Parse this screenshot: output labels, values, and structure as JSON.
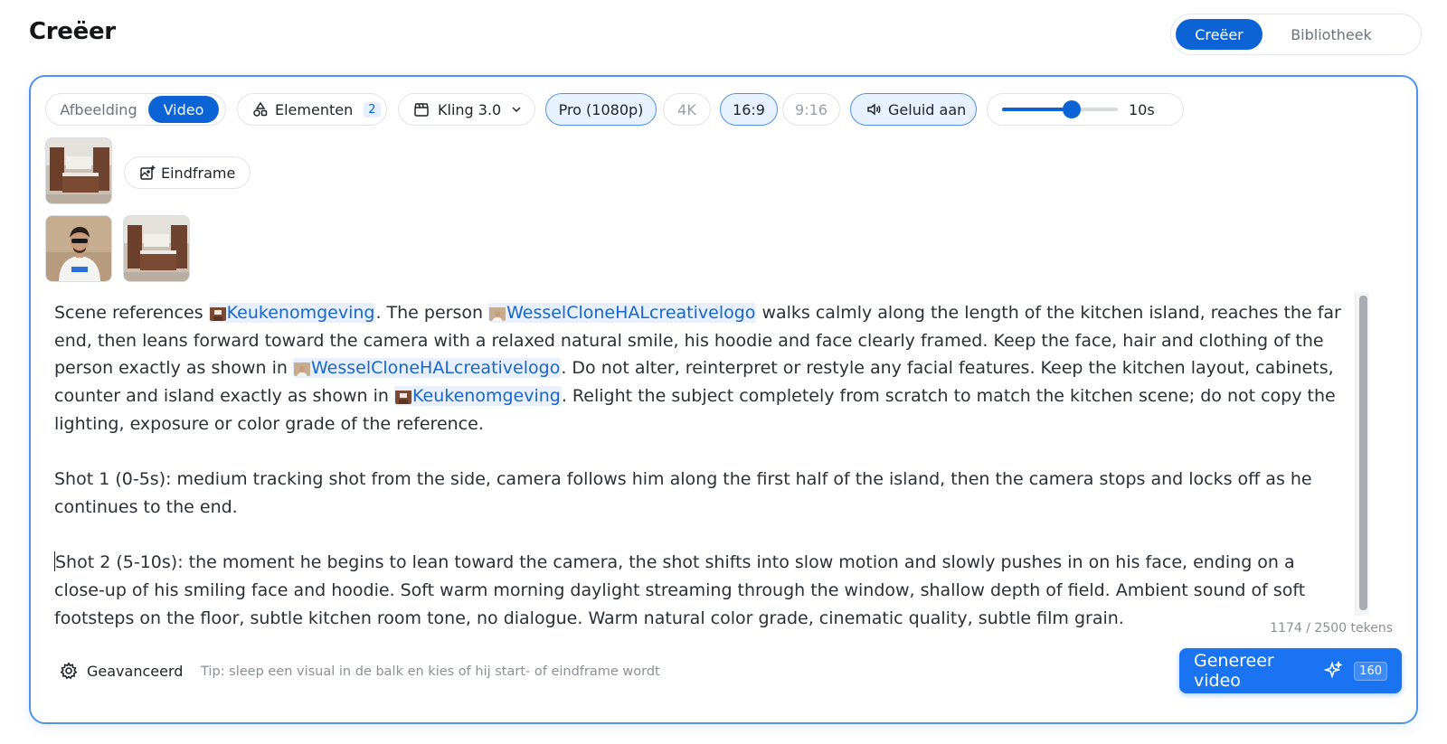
{
  "header": {
    "title": "Creëer",
    "tabs": [
      {
        "label": "Creëer",
        "active": true
      },
      {
        "label": "Bibliotheek",
        "active": false
      }
    ]
  },
  "toolbar": {
    "mode_tabs": [
      {
        "label": "Afbeelding",
        "active": false
      },
      {
        "label": "Video",
        "active": true
      }
    ],
    "elements": {
      "label": "Elementen",
      "count": "2",
      "icon": "shapes-icon"
    },
    "model": {
      "label": "Kling 3.0",
      "icon": "clapperboard-icon"
    },
    "quality": [
      {
        "label": "Pro (1080p)",
        "selected": true
      },
      {
        "label": "4K",
        "selected": false
      }
    ],
    "aspect": [
      {
        "label": "16:9",
        "selected": true
      },
      {
        "label": "9:16",
        "selected": false
      }
    ],
    "sound": {
      "label": "Geluid aan",
      "icon": "speaker-icon"
    },
    "duration": {
      "value_label": "10s",
      "fraction": 0.6
    }
  },
  "references": {
    "end_frame_button": "Eindframe"
  },
  "prompt": {
    "p1_a": "Scene references ",
    "mention_kitchen": "Keukenomgeving",
    "p1_b": ". The person ",
    "mention_person": "WesselCloneHALcreativelogo",
    "p1_c": " walks calmly along the length of the kitchen island, reaches the far end, then leans forward toward the camera with a relaxed natural smile, his hoodie and face clearly framed. Keep the face, hair and clothing of the person exactly as shown in ",
    "p1_d": ". Do not alter, reinterpret or restyle any facial features. Keep the kitchen layout, cabinets, counter and island exactly as shown in ",
    "p1_e": ". Relight the subject completely from scratch to match the kitchen scene; do not copy the lighting, exposure or color grade of the reference.",
    "p2": "Shot 1 (0-5s): medium tracking shot from the side, camera follows him along the first half of the island, then the camera stops and locks off as he continues to the end.",
    "p3": "Shot 2 (5-10s): the moment he begins to lean toward the camera, the shot shifts into slow motion and slowly pushes in on his face, ending on a close-up of his smiling face and hoodie. Soft warm morning daylight streaming through the window, shallow depth of field. Ambient sound of soft footsteps on the floor, subtle kitchen room tone, no dialogue. Warm natural color grade, cinematic quality, subtle film grain."
  },
  "counter": "1174 / 2500 tekens",
  "footer": {
    "advanced_label": "Geavanceerd",
    "tip": "Tip: sleep een visual in de balk en kies of hij start- of eindframe wordt",
    "generate_label": "Genereer video",
    "generate_cost": "160"
  },
  "colors": {
    "accent": "#0b63d6",
    "panel_border": "#4f93ec",
    "mention_bg": "#e7f0fc",
    "mention_text": "#1a66c9"
  }
}
